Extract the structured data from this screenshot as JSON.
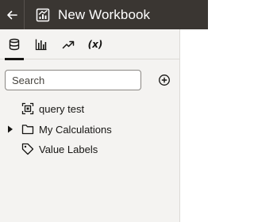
{
  "header": {
    "title": "New Workbook",
    "back_icon": "arrow-left-icon",
    "workbook_icon": "workbook-chart-icon"
  },
  "tabs": [
    {
      "name": "data",
      "icon": "database-icon",
      "active": true
    },
    {
      "name": "visualizations",
      "icon": "bar-chart-icon",
      "active": false
    },
    {
      "name": "analytics",
      "icon": "trend-line-icon",
      "active": false
    },
    {
      "name": "calculations",
      "icon": "function-icon",
      "label": "(x)",
      "active": false
    }
  ],
  "search": {
    "placeholder": "Search",
    "value": ""
  },
  "add_icon": "add-circle-icon",
  "tree": {
    "items": [
      {
        "label": "query test",
        "icon": "dataset-icon",
        "expandable": false
      },
      {
        "label": "My Calculations",
        "icon": "folder-icon",
        "expandable": true
      },
      {
        "label": "Value Labels",
        "icon": "tag-icon",
        "expandable": false
      }
    ]
  },
  "colors": {
    "header_bg": "#3a3632",
    "panel_bg": "#f4f3f1",
    "text": "#161513"
  }
}
